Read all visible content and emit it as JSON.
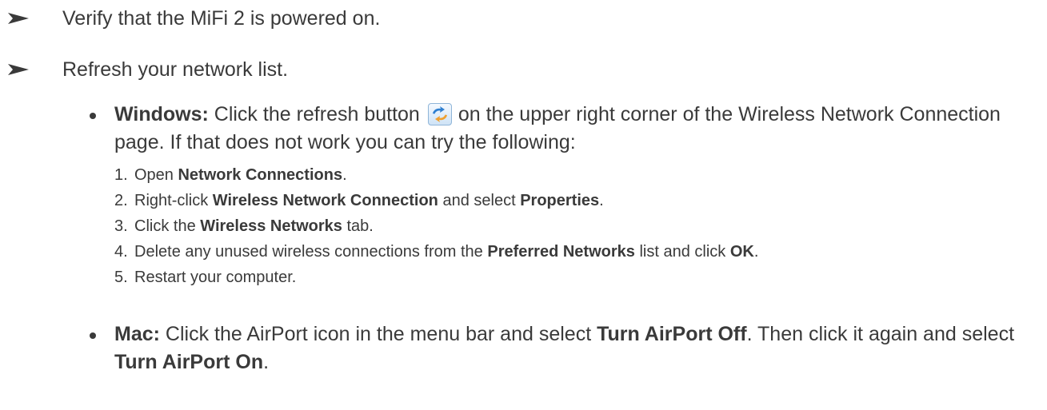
{
  "items": [
    {
      "text": "Verify that the MiFi 2 is powered on."
    },
    {
      "text": "Refresh your network list."
    }
  ],
  "windows": {
    "label": "Windows:",
    "text_before_icon": "Click the refresh button",
    "text_after_icon": "on the upper right corner of the Wireless Network Connection page. If that does not work you can try the following:",
    "icon": "refresh-icon"
  },
  "steps": [
    {
      "num": "1.",
      "pre": "Open ",
      "bold": "Network Connections",
      "post": "."
    },
    {
      "num": "2.",
      "pre": "Right-click ",
      "bold": "Wireless Network Connection",
      "mid": " and select ",
      "bold2": "Properties",
      "post": "."
    },
    {
      "num": "3.",
      "pre": "Click the ",
      "bold": "Wireless Networks",
      "post": " tab."
    },
    {
      "num": "4.",
      "pre": "Delete any unused wireless connections from the ",
      "bold": "Preferred Networks",
      "mid": " list and click ",
      "bold2": "OK",
      "post": "."
    },
    {
      "num": "5.",
      "pre": "Restart your computer.",
      "post": ""
    }
  ],
  "mac": {
    "label": "Mac:",
    "pre": "Click the AirPort icon in the menu bar and select ",
    "bold": "Turn AirPort Off",
    "mid": ". Then click it again and select ",
    "bold2": "Turn AirPort On",
    "post": "."
  },
  "colors": {
    "text": "#3a3a3a",
    "icon_border": "#8fb5d8",
    "icon_fill": "#cfe3f6",
    "icon_arrow_blue": "#2f7fd0",
    "icon_arrow_orange": "#f0a030"
  }
}
